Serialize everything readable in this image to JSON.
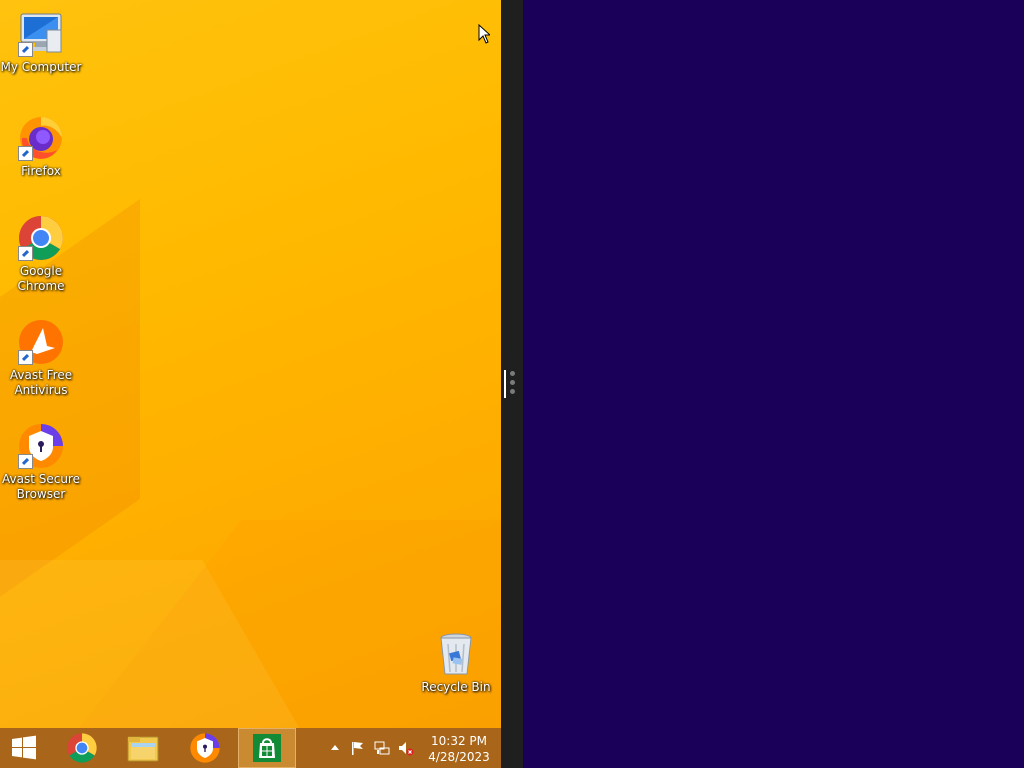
{
  "desktop": {
    "icons": [
      {
        "label": "My Computer",
        "icon": "computer-icon"
      },
      {
        "label": "Firefox",
        "icon": "firefox-icon"
      },
      {
        "label": "Google Chrome",
        "icon": "chrome-icon"
      },
      {
        "label": "Avast Free Antivirus",
        "icon": "avast-antivirus-icon"
      },
      {
        "label": "Avast Secure Browser",
        "icon": "avast-browser-icon"
      },
      {
        "label": "Recycle Bin",
        "icon": "recycle-bin-icon"
      }
    ]
  },
  "taskbar": {
    "buttons": [
      {
        "name": "start",
        "icon": "windows-logo-icon"
      },
      {
        "name": "chrome",
        "icon": "chrome-icon"
      },
      {
        "name": "file-explorer",
        "icon": "folder-icon"
      },
      {
        "name": "avast-secure-browser",
        "icon": "avast-browser-icon"
      },
      {
        "name": "store",
        "icon": "store-icon",
        "active": true
      }
    ],
    "tray": {
      "icons": [
        "show-hidden-icons",
        "action-center-flag-icon",
        "network-icon",
        "volume-muted-icon"
      ],
      "time": "10:32 PM",
      "date": "4/28/2023"
    }
  },
  "colors": {
    "desktop_bg": "#ffb800",
    "app_pane_bg": "#1a0058",
    "divider": "#1f1f1f",
    "taskbar": "#a9661a"
  }
}
